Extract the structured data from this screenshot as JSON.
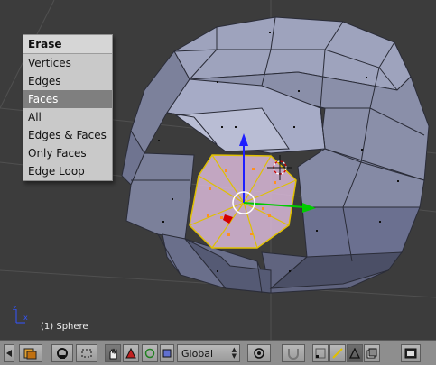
{
  "menu": {
    "title": "Erase",
    "items": [
      "Vertices",
      "Edges",
      "Faces",
      "All",
      "Edges & Faces",
      "Only Faces",
      "Edge Loop"
    ],
    "active_index": 2
  },
  "viewport": {
    "object_label": "(1) Sphere"
  },
  "toolbar": {
    "orientation_value": "Global"
  },
  "colors": {
    "viewport_bg": "#3c3c3c",
    "mesh": "#8e93ad",
    "selected_faces": "#d9b8d8",
    "selected_edges": "#e0c000",
    "axis_x": "#00cc00",
    "axis_z": "#1f1fff"
  }
}
